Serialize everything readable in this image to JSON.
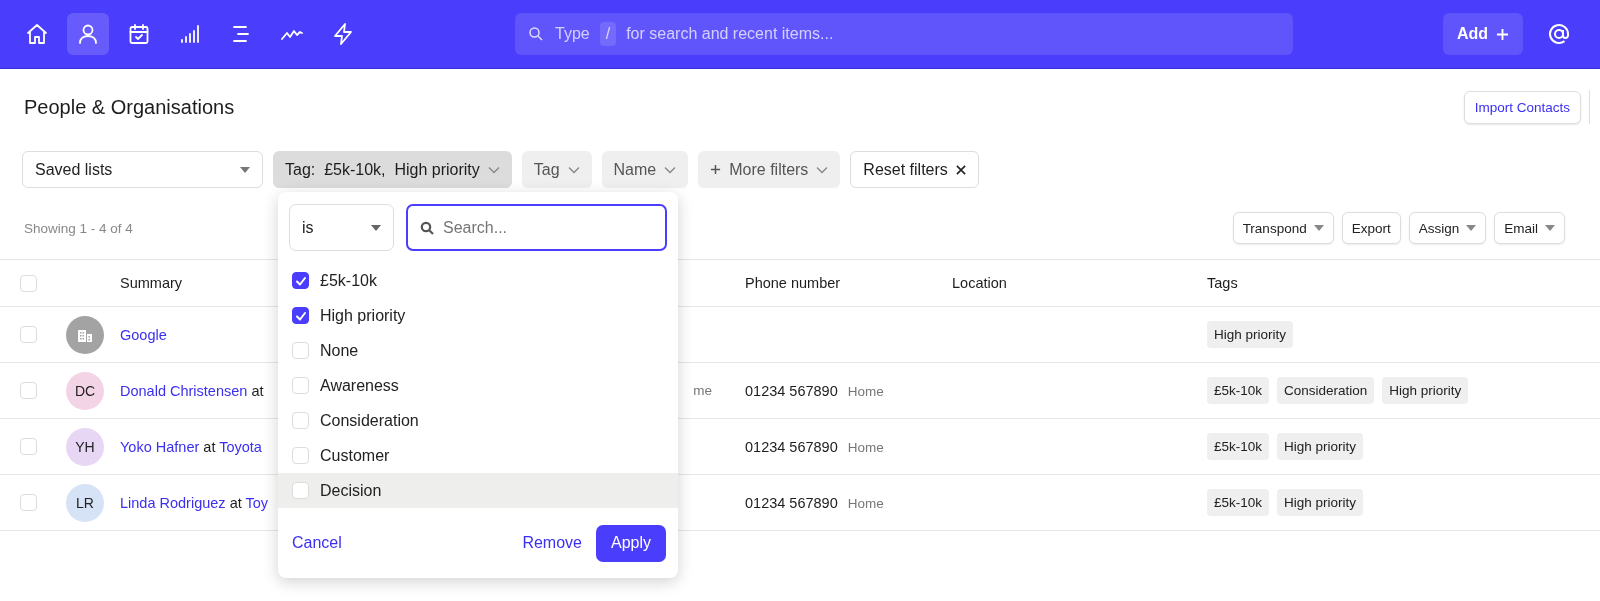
{
  "top_bar": {
    "nav_items": [
      {
        "selected": false
      },
      {
        "selected": true
      },
      {
        "selected": false
      },
      {
        "selected": false
      },
      {
        "selected": false
      },
      {
        "selected": false
      },
      {
        "selected": false
      }
    ],
    "search": {
      "prefix": "Type",
      "key": "/",
      "suffix": "for search and recent items..."
    },
    "add_button": "Add"
  },
  "page": {
    "title": "People & Organisations",
    "import_button": "Import Contacts"
  },
  "filters": [
    {
      "kind": "select",
      "label": "Saved lists"
    },
    {
      "kind": "chip",
      "label": "Tag:  £5k-10k,  High priority",
      "open": true
    },
    {
      "kind": "chip",
      "label": "Tag",
      "open": false
    },
    {
      "kind": "chip",
      "label": "Name",
      "open": false
    },
    {
      "kind": "add-chip",
      "label": "More filters",
      "open": false
    },
    {
      "kind": "reset",
      "label": "Reset filters"
    }
  ],
  "showing": "Showing 1 - 4 of 4",
  "actions": [
    {
      "label": "Transpond",
      "menu": true
    },
    {
      "label": "Export",
      "menu": false
    },
    {
      "label": "Assign",
      "menu": true
    },
    {
      "label": "Email",
      "menu": true
    }
  ],
  "table": {
    "columns": {
      "summary": "Summary",
      "phone": "Phone number",
      "location": "Location",
      "tags": "Tags"
    },
    "header_checked": false,
    "rows": [
      {
        "checked": false,
        "avatar": {
          "kind": "organisation",
          "color": "#a3a3a3"
        },
        "name": "Google",
        "tags": [
          "High priority"
        ]
      },
      {
        "checked": false,
        "avatar": {
          "kind": "person",
          "initials": "DC",
          "color": "#f3d3e6"
        },
        "name": "Donald Christensen",
        "joiner": "at",
        "column_3": "me",
        "phone": "01234 567890",
        "phone_label": "Home",
        "tags": [
          "£5k-10k",
          "Consideration",
          "High priority"
        ]
      },
      {
        "checked": false,
        "avatar": {
          "kind": "person",
          "initials": "YH",
          "color": "#e8d7f4"
        },
        "name": "Yoko Hafner",
        "joiner": "at",
        "org": "Toyota",
        "phone": "01234 567890",
        "phone_label": "Home",
        "tags": [
          "£5k-10k",
          "High priority"
        ]
      },
      {
        "checked": false,
        "avatar": {
          "kind": "person",
          "initials": "LR",
          "color": "#d6e2f6"
        },
        "name": "Linda Rodriguez",
        "joiner": "at",
        "org": "Toy",
        "phone": "01234 567890",
        "phone_label": "Home",
        "tags": [
          "£5k-10k",
          "High priority"
        ]
      }
    ]
  },
  "tag_dropdown": {
    "operator": "is",
    "search": {
      "placeholder": "Search...",
      "focused": true
    },
    "options": [
      {
        "label": "£5k-10k",
        "checked": true,
        "hovered": false
      },
      {
        "label": "High priority",
        "checked": true,
        "hovered": false
      },
      {
        "label": "None",
        "checked": false,
        "hovered": false
      },
      {
        "label": "Awareness",
        "checked": false,
        "hovered": false
      },
      {
        "label": "Consideration",
        "checked": false,
        "hovered": false
      },
      {
        "label": "Customer",
        "checked": false,
        "hovered": false
      },
      {
        "label": "Decision",
        "checked": false,
        "hovered": true
      }
    ],
    "cancel": "Cancel",
    "remove": "Remove",
    "apply": "Apply"
  }
}
